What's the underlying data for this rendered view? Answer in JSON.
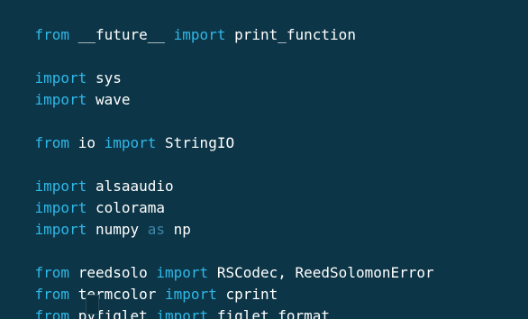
{
  "editor": {
    "lines": {
      "l1": {
        "kw1": "from",
        "mod": " __future__ ",
        "kw2": "import",
        "name": " print_function"
      },
      "l3": {
        "kw": "import",
        "mod": " sys"
      },
      "l4": {
        "kw": "import",
        "mod": " wave"
      },
      "l6": {
        "kw1": "from",
        "mod": " io ",
        "kw2": "import",
        "name": " StringIO"
      },
      "l8": {
        "kw": "import",
        "mod": " alsaaudio"
      },
      "l9": {
        "kw": "import",
        "mod": " colorama"
      },
      "l10": {
        "kw": "import",
        "mod": " numpy ",
        "as": "as",
        "alias": " np"
      },
      "l12": {
        "kw1": "from",
        "mod": " reedsolo ",
        "kw2": "import",
        "name": " RSCodec, ReedSolomonError"
      },
      "l13": {
        "kw1": "from",
        "mod": " termcolor ",
        "kw2": "import",
        "name": " cprint"
      },
      "l14": {
        "kw1": "from",
        "mod": " pyfiglet ",
        "kw2": "import",
        "name": " figlet_format"
      }
    },
    "colors": {
      "background": "#0c3547",
      "keyword": "#2fb8e8",
      "as_keyword": "#3f88a8",
      "text": "#ffffff"
    }
  }
}
